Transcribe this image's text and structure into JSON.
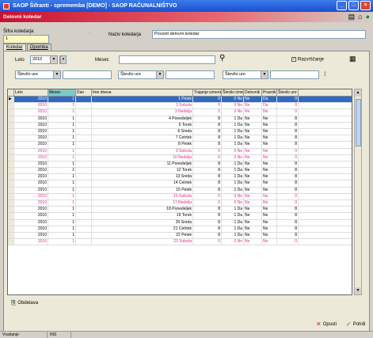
{
  "window": {
    "title": "SAOP  Šifranti - sprememba [DEMO] - SAOP RAČUNALNIŠTVO",
    "subtitle": "Delovni koledar"
  },
  "header": {
    "sifra_label": "Šifra koledarja",
    "sifra_value": "1",
    "naziv_label": "Naziv koledarja",
    "naziv_value": "Povzeti delovni koledar"
  },
  "tabs": [
    {
      "label": "Koledar"
    },
    {
      "label": "Opomba"
    }
  ],
  "filters": {
    "leto_label": "Leto",
    "leto_value": "2010",
    "mesec_label": "Mesec",
    "mesec_value": "",
    "razvrscanje_label": "Razvrščanje",
    "f1_value": "Število ure",
    "f2_value": "Število ure",
    "f3_value": "Število ure"
  },
  "grid": {
    "columns": [
      "Leto",
      "Mesec",
      "Dan",
      "Ime dneva",
      "Trajanje izmene",
      "Število izmen",
      "Delovnik",
      "Praznik",
      "Število ure"
    ],
    "rows": [
      {
        "leto": "2010",
        "mesec": "1",
        "dan": "",
        "ime": "1 Petek",
        "traj": "0",
        "stev": "0 Ne",
        "del": "Ne",
        "praz": "Da",
        "ure": "0",
        "weekend": false,
        "selected": true
      },
      {
        "leto": "2010",
        "mesec": "1",
        "dan": "",
        "ime": "2 Sobota",
        "traj": "0",
        "stev": "0 Ne",
        "del": "Ne",
        "praz": "Da",
        "ure": "0",
        "weekend": true,
        "selected": false
      },
      {
        "leto": "2010",
        "mesec": "1",
        "dan": "",
        "ime": "3 Nedelja",
        "traj": "0",
        "stev": "0 Ne",
        "del": "Ne",
        "praz": "Ne",
        "ure": "0",
        "weekend": true,
        "selected": false
      },
      {
        "leto": "2010",
        "mesec": "1",
        "dan": "",
        "ime": "4 Ponedeljek",
        "traj": "8",
        "stev": "1 Da",
        "del": "Ne",
        "praz": "Ne",
        "ure": "8",
        "weekend": false,
        "selected": false
      },
      {
        "leto": "2010",
        "mesec": "1",
        "dan": "",
        "ime": "5 Torek",
        "traj": "8",
        "stev": "1 Da",
        "del": "Ne",
        "praz": "Ne",
        "ure": "8",
        "weekend": false,
        "selected": false
      },
      {
        "leto": "2010",
        "mesec": "1",
        "dan": "",
        "ime": "6 Sreda",
        "traj": "8",
        "stev": "1 Da",
        "del": "Ne",
        "praz": "Ne",
        "ure": "8",
        "weekend": false,
        "selected": false
      },
      {
        "leto": "2010",
        "mesec": "1",
        "dan": "",
        "ime": "7 Četrtek",
        "traj": "8",
        "stev": "1 Da",
        "del": "Ne",
        "praz": "Ne",
        "ure": "8",
        "weekend": false,
        "selected": false
      },
      {
        "leto": "2010",
        "mesec": "1",
        "dan": "",
        "ime": "8 Petek",
        "traj": "8",
        "stev": "1 Da",
        "del": "Ne",
        "praz": "Ne",
        "ure": "8",
        "weekend": false,
        "selected": false
      },
      {
        "leto": "2010",
        "mesec": "1",
        "dan": "",
        "ime": "9 Sobota",
        "traj": "0",
        "stev": "0 Ne",
        "del": "Ne",
        "praz": "Ne",
        "ure": "0",
        "weekend": true,
        "selected": false
      },
      {
        "leto": "2010",
        "mesec": "1",
        "dan": "",
        "ime": "10 Nedelja",
        "traj": "0",
        "stev": "0 Ne",
        "del": "Ne",
        "praz": "Ne",
        "ure": "0",
        "weekend": true,
        "selected": false
      },
      {
        "leto": "2010",
        "mesec": "1",
        "dan": "",
        "ime": "11 Ponedeljek",
        "traj": "8",
        "stev": "1 Da",
        "del": "Ne",
        "praz": "Ne",
        "ure": "8",
        "weekend": false,
        "selected": false
      },
      {
        "leto": "2010",
        "mesec": "1",
        "dan": "",
        "ime": "12 Torek",
        "traj": "8",
        "stev": "1 Da",
        "del": "Ne",
        "praz": "Ne",
        "ure": "8",
        "weekend": false,
        "selected": false
      },
      {
        "leto": "2010",
        "mesec": "1",
        "dan": "",
        "ime": "13 Sreda",
        "traj": "8",
        "stev": "1 Da",
        "del": "Ne",
        "praz": "Ne",
        "ure": "8",
        "weekend": false,
        "selected": false
      },
      {
        "leto": "2010",
        "mesec": "1",
        "dan": "",
        "ime": "14 Četrtek",
        "traj": "8",
        "stev": "1 Da",
        "del": "Ne",
        "praz": "Ne",
        "ure": "8",
        "weekend": false,
        "selected": false
      },
      {
        "leto": "2010",
        "mesec": "1",
        "dan": "",
        "ime": "15 Petek",
        "traj": "8",
        "stev": "1 Da",
        "del": "Ne",
        "praz": "Ne",
        "ure": "8",
        "weekend": false,
        "selected": false
      },
      {
        "leto": "2010",
        "mesec": "1",
        "dan": "",
        "ime": "16 Sobota",
        "traj": "0",
        "stev": "0 Ne",
        "del": "Ne",
        "praz": "Ne",
        "ure": "0",
        "weekend": true,
        "selected": false
      },
      {
        "leto": "2010",
        "mesec": "1",
        "dan": "",
        "ime": "17 Nedelja",
        "traj": "0",
        "stev": "0 Ne",
        "del": "Ne",
        "praz": "Ne",
        "ure": "0",
        "weekend": true,
        "selected": false
      },
      {
        "leto": "2010",
        "mesec": "1",
        "dan": "",
        "ime": "18 Ponedeljek",
        "traj": "8",
        "stev": "1 Da",
        "del": "Ne",
        "praz": "Ne",
        "ure": "8",
        "weekend": false,
        "selected": false
      },
      {
        "leto": "2010",
        "mesec": "1",
        "dan": "",
        "ime": "19 Torek",
        "traj": "8",
        "stev": "1 Da",
        "del": "Ne",
        "praz": "Ne",
        "ure": "8",
        "weekend": false,
        "selected": false
      },
      {
        "leto": "2010",
        "mesec": "1",
        "dan": "",
        "ime": "20 Sreda",
        "traj": "8",
        "stev": "1 Da",
        "del": "Ne",
        "praz": "Ne",
        "ure": "8",
        "weekend": false,
        "selected": false
      },
      {
        "leto": "2010",
        "mesec": "1",
        "dan": "",
        "ime": "21 Četrtek",
        "traj": "8",
        "stev": "1 Da",
        "del": "Ne",
        "praz": "Ne",
        "ure": "8",
        "weekend": false,
        "selected": false
      },
      {
        "leto": "2010",
        "mesec": "1",
        "dan": "",
        "ime": "22 Petek",
        "traj": "8",
        "stev": "1 Da",
        "del": "Ne",
        "praz": "Ne",
        "ure": "8",
        "weekend": false,
        "selected": false
      },
      {
        "leto": "2010",
        "mesec": "1",
        "dan": "",
        "ime": "23 Sobota",
        "traj": "0",
        "stev": "0 Ne",
        "del": "Ne",
        "praz": "Ne",
        "ure": "0",
        "weekend": true,
        "selected": false
      }
    ]
  },
  "buttons": {
    "obdelava": "Obdelava",
    "opusti": "Opusti",
    "potrdi": "Potrdi"
  },
  "status": {
    "s1": "Vnašanje",
    "s2": "INS"
  },
  "colors": {
    "weekend": "#e0308a",
    "selection": "#316ac5",
    "title": "#1b4fd1",
    "subtitle": "#c8102e"
  }
}
